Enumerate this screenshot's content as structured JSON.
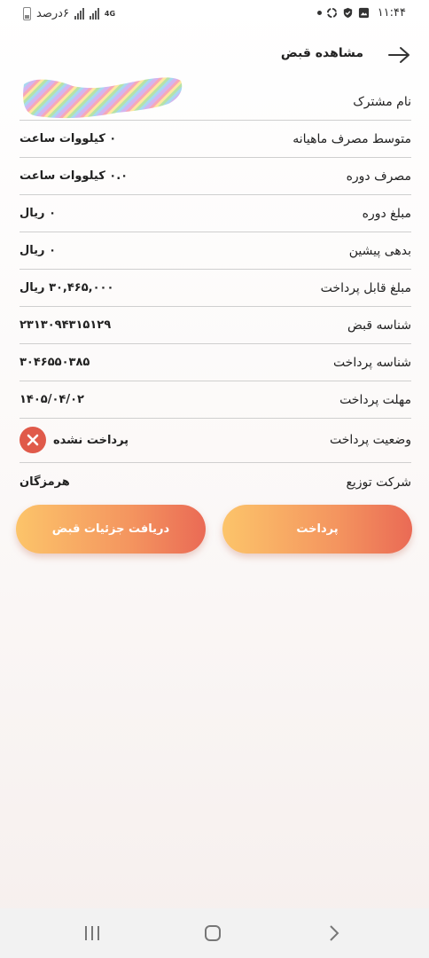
{
  "status_bar": {
    "time": "۱۱:۴۴",
    "battery_text": "۶درصد",
    "network_label": "4G",
    "icons": [
      "battery-icon",
      "signal-icon",
      "signal-icon",
      "network-4g-icon",
      "dot-icon",
      "sync-icon",
      "shield-check-icon",
      "image-icon"
    ]
  },
  "header": {
    "title": "مشاهده قبض",
    "back_icon": "arrow-back-icon"
  },
  "bill": {
    "rows": [
      {
        "label": "نام مشترک",
        "value": ""
      },
      {
        "label": "متوسط مصرف ماهیانه",
        "value": "۰ کیلووات ساعت"
      },
      {
        "label": "مصرف دوره",
        "value": "۰.۰ کیلووات ساعت"
      },
      {
        "label": "مبلغ دوره",
        "value": "۰ ریال"
      },
      {
        "label": "بدهی پیشین",
        "value": "۰ ریال"
      },
      {
        "label": "مبلغ قابل پرداخت",
        "value": "۳۰,۴۶۵,۰۰۰ ریال"
      },
      {
        "label": "شناسه قبض",
        "value": "۲۳۱۳۰۹۴۳۱۵۱۲۹"
      },
      {
        "label": "شناسه پرداخت",
        "value": "۳۰۴۶۵۵۰۳۸۵"
      },
      {
        "label": "مهلت پرداخت",
        "value": "۱۴۰۵/۰۴/۰۲"
      },
      {
        "label": "وضعیت پرداخت",
        "value": "پرداخت نشده"
      },
      {
        "label": "شرکت توزیع",
        "value": "هرمزگان"
      }
    ]
  },
  "buttons": {
    "pay": "پرداخت",
    "details": "دریافت جزئیات قبض"
  },
  "colors": {
    "accent_start": "#fcc46a",
    "accent_end": "#ea6a55",
    "unpaid": "#e05a4a"
  }
}
